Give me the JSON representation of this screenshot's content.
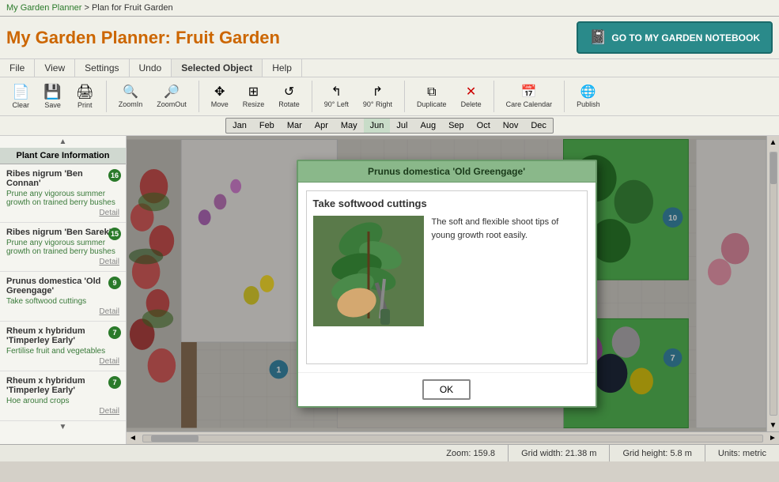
{
  "breadcrumb": {
    "link_text": "My Garden Planner",
    "separator": " > ",
    "current": "Plan for Fruit Garden"
  },
  "title": {
    "prefix": "My Garden Planner: ",
    "garden_name": "Fruit Garden"
  },
  "notebook_button": {
    "label": "GO TO MY GARDEN NOTEBOOK",
    "icon": "📓"
  },
  "menu": {
    "items": [
      "File",
      "View",
      "Settings",
      "Undo",
      "Selected Object",
      "Help"
    ]
  },
  "toolbar": {
    "buttons": [
      {
        "label": "Clear",
        "icon": "📄"
      },
      {
        "label": "Save",
        "icon": "💾"
      },
      {
        "label": "Print",
        "icon": "🖨"
      },
      {
        "label": "ZoomIn",
        "icon": "🔍"
      },
      {
        "label": "ZoomOut",
        "icon": "🔎"
      },
      {
        "label": "Move",
        "icon": "✥"
      },
      {
        "label": "Resize",
        "icon": "⊞"
      },
      {
        "label": "Rotate",
        "icon": "↺"
      },
      {
        "label": "90° Left",
        "icon": "↰"
      },
      {
        "label": "90° Right",
        "icon": "↱"
      },
      {
        "label": "Duplicate",
        "icon": "⧉"
      },
      {
        "label": "Delete",
        "icon": "✕"
      },
      {
        "label": "Care Calendar",
        "icon": "📅"
      },
      {
        "label": "Publish",
        "icon": "🌐"
      }
    ]
  },
  "months": [
    "Jan",
    "Feb",
    "Mar",
    "Apr",
    "May",
    "Jun",
    "Jul",
    "Aug",
    "Sep",
    "Oct",
    "Nov",
    "Dec"
  ],
  "sidebar": {
    "title": "Plant Care Information",
    "items": [
      {
        "name": "Ribes nigrum 'Ben Connan'",
        "badge": "16",
        "care": "Prune any vigorous summer growth on trained berry bushes",
        "detail": "Detail"
      },
      {
        "name": "Ribes nigrum 'Ben Sarek'",
        "badge": "15",
        "care": "Prune any vigorous summer growth on trained berry bushes",
        "detail": "Detail"
      },
      {
        "name": "Prunus domestica 'Old Greengage'",
        "badge": "9",
        "care": "Take softwood cuttings",
        "detail": "Detail"
      },
      {
        "name": "Rheum x hybridum 'Timperley Early'",
        "badge": "7",
        "care": "Fertilise fruit and vegetables",
        "detail": "Detail"
      },
      {
        "name": "Rheum x hybridum 'Timperley Early'",
        "badge": "7",
        "care": "Hoe around crops",
        "detail": "Detail"
      }
    ]
  },
  "modal": {
    "title": "Prunus domestica 'Old Greengage'",
    "heading": "Take softwood cuttings",
    "text": "The soft and flexible shoot tips of young growth root easily.",
    "ok_label": "OK",
    "image_alt": "Softwood cutting technique"
  },
  "status": {
    "zoom": "Zoom: 159.8",
    "grid_width": "Grid width: 21.38 m",
    "grid_height": "Grid height: 5.8 m",
    "units": "Units: metric"
  }
}
